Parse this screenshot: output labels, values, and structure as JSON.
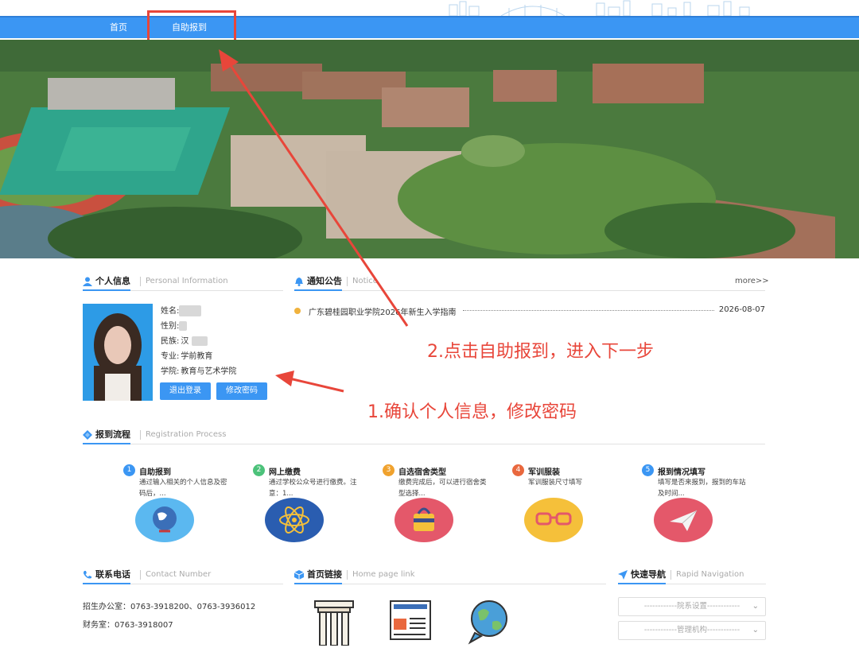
{
  "nav": {
    "home": "首页",
    "self_register": "自助报到"
  },
  "personal": {
    "title": "个人信息",
    "subtitle": "Personal Information",
    "name_label": "姓名:",
    "gender_label": "性别:",
    "ethnicity_label": "民族:",
    "ethnicity_value": "汉",
    "major_label": "专业:",
    "major_value": "学前教育",
    "college_label": "学院:",
    "college_value": "教育与艺术学院",
    "logout_button": "退出登录",
    "change_password_button": "修改密码"
  },
  "notice": {
    "title": "通知公告",
    "subtitle": "Notice",
    "more": "more>>",
    "items": [
      {
        "title": "广东碧桂园职业学院2026年新生入学指南",
        "date": "2026-08-07"
      }
    ]
  },
  "annotations": {
    "step2": "2.点击自助报到，进入下一步",
    "step1": "1.确认个人信息，修改密码"
  },
  "process": {
    "title": "报到流程",
    "subtitle": "Registration Process",
    "steps": [
      {
        "num": "1",
        "title": "自助报到",
        "desc": "通过输入相关的个人信息及密码后，...",
        "color": "#3b96f3",
        "icon": "globe-icon"
      },
      {
        "num": "2",
        "title": "网上缴费",
        "desc": "通过学校公众号进行缴费。注意：1...",
        "color": "#4cc27a",
        "icon": "atom-icon"
      },
      {
        "num": "3",
        "title": "自选宿舍类型",
        "desc": "缴费完成后，可以进行宿舍类型选择...",
        "color": "#f0a22e",
        "icon": "bag-icon"
      },
      {
        "num": "4",
        "title": "军训服装",
        "desc": "军训服装尺寸填写",
        "color": "#e9683e",
        "icon": "glasses-icon"
      },
      {
        "num": "5",
        "title": "报到情况填写",
        "desc": "填写是否来报到，报到的车站及时间...",
        "color": "#3b96f3",
        "icon": "paper-plane-icon"
      }
    ]
  },
  "contact": {
    "title": "联系电话",
    "subtitle": "Contact Number",
    "line1": "招生办公室：0763-3918200、0763-3936012",
    "line2": "财务室：0763-3918007"
  },
  "links": {
    "title": "首页链接",
    "subtitle": "Home page link"
  },
  "quicknav": {
    "title": "快速导航",
    "subtitle": "Rapid Navigation",
    "select1": "------------院系设置------------",
    "select2": "------------管理机构------------"
  }
}
